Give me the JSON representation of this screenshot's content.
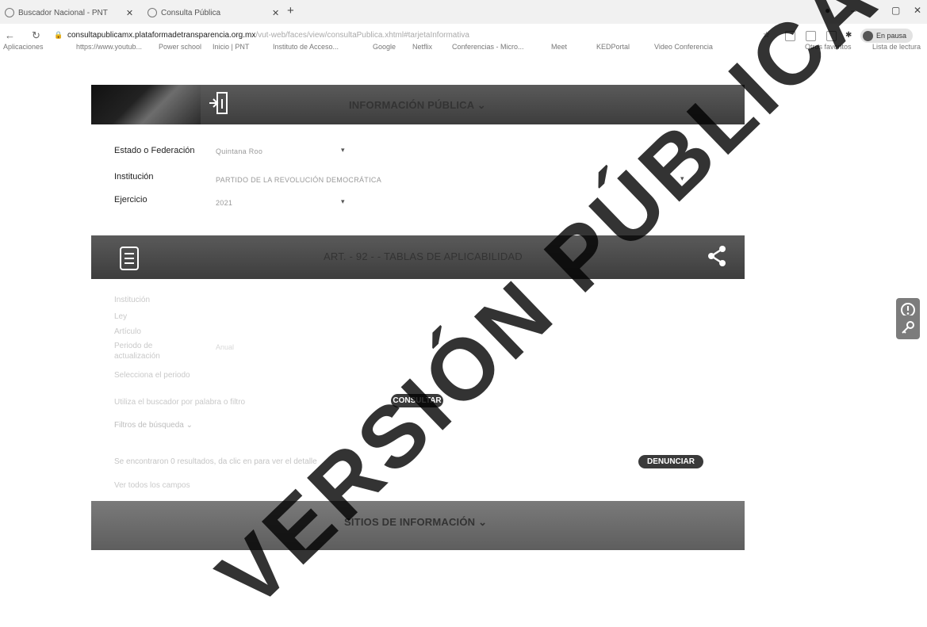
{
  "browser": {
    "tabs": [
      {
        "label": "Buscador Nacional - PNT"
      },
      {
        "label": "Consulta Pública"
      }
    ],
    "new_tab": "+",
    "window_controls": [
      "–",
      "▢",
      "✕"
    ],
    "url_host": "consultapublicamx.plataformadetransparencia.org.mx",
    "url_rest": "/vut-web/faces/view/consultaPublica.xhtml#tarjetaInformativa",
    "profile_label": "En pausa",
    "bookmarks": [
      "Aplicaciones",
      "https://www.youtub...",
      "Power school",
      "Inicio | PNT",
      "Instituto de Acceso...",
      "Google",
      "Netflix",
      "Conferencias - Micro...",
      "Meet",
      "KEDPortal",
      "Video Conferencia",
      "Otros favoritos",
      "Lista de lectura"
    ]
  },
  "header_band": {
    "title": "INFORMACIÓN PÚBLICA"
  },
  "filters": {
    "estado_label": "Estado o Federación",
    "estado_value": "Quintana Roo",
    "institucion_label": "Institución",
    "institucion_value": "PARTIDO DE LA REVOLUCIÓN DEMOCRÁTICA",
    "ejercicio_label": "Ejercicio",
    "ejercicio_value": "2021"
  },
  "article_band": {
    "title": "ART. - 92 - - TABLAS DE APLICABILIDAD"
  },
  "details": {
    "institucion_label": "Institución",
    "ley_label": "Ley",
    "articulo_label": "Artículo",
    "periodo_label": "Periodo de actualización",
    "periodo_value": "Anual",
    "seleccione_label": "Selecciona el periodo",
    "busqueda_text": "Utiliza el buscador por palabra o filtro",
    "filtros_label": "Filtros de búsqueda",
    "resultados_text": "Se encontraron 0 resultados, da clic en para ver el detalle",
    "ver_campos": "Ver todos los campos"
  },
  "buttons": {
    "consultar": "CONSULTAR",
    "denunciar": "DENUNCIAR"
  },
  "sites_band": {
    "title": "SITIOS DE INFORMACIÓN"
  },
  "watermark": "VERSIÓN PÚBLICA",
  "colors": {
    "band": "#4a4a4a",
    "pill": "#3a3a3a",
    "side_button": "#7c7c7c"
  }
}
